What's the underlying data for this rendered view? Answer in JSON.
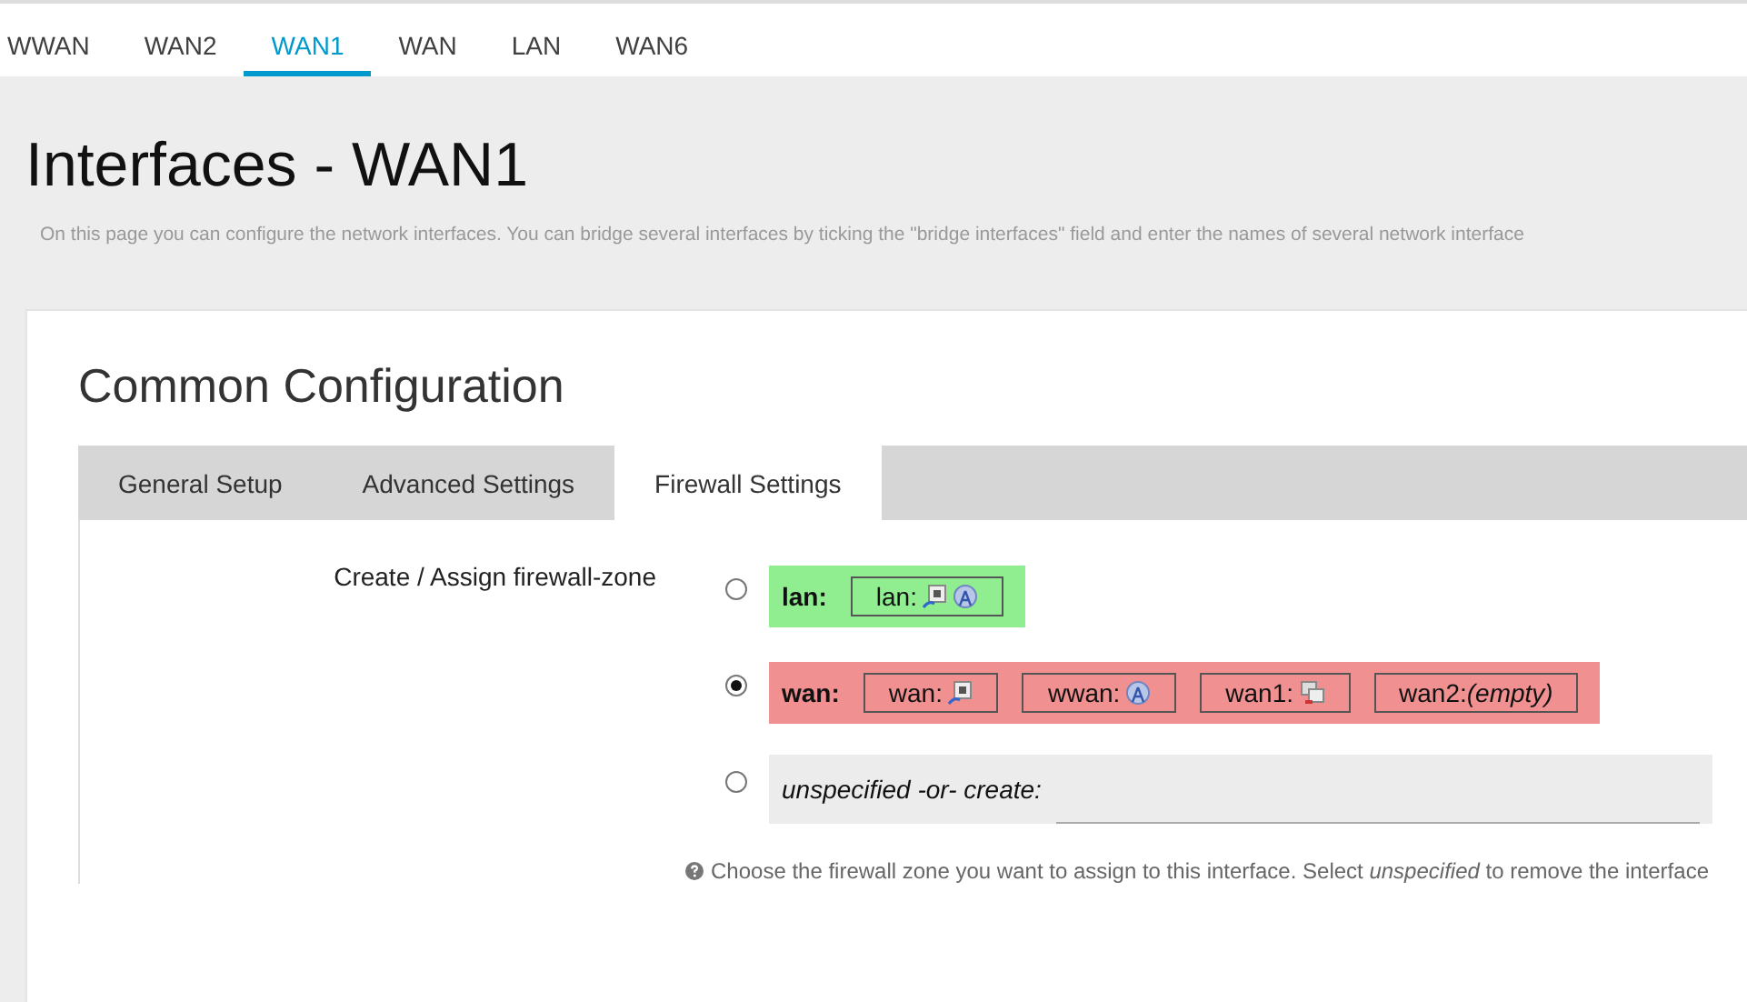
{
  "top_tabs": [
    {
      "label": "WWAN",
      "selected": false
    },
    {
      "label": "WAN2",
      "selected": false
    },
    {
      "label": "WAN1",
      "selected": true
    },
    {
      "label": "WAN",
      "selected": false
    },
    {
      "label": "LAN",
      "selected": false
    },
    {
      "label": "WAN6",
      "selected": false
    }
  ],
  "title": "Interfaces - WAN1",
  "description": "On this page you can configure the network interfaces. You can bridge several interfaces by ticking the \"bridge interfaces\" field and enter the names of several network interface",
  "section_title": "Common Configuration",
  "section_tabs": [
    {
      "label": "General Setup",
      "selected": false
    },
    {
      "label": "Advanced Settings",
      "selected": false
    },
    {
      "label": "Firewall Settings",
      "selected": true
    }
  ],
  "field_label": "Create / Assign firewall-zone",
  "zones": [
    {
      "kind": "zone",
      "name": "lan:",
      "color": "#90ee90",
      "selected": false,
      "members": [
        {
          "label": "lan:",
          "icons": [
            {
              "kind": "ethernet"
            },
            {
              "kind": "wireless"
            }
          ]
        }
      ]
    },
    {
      "kind": "zone",
      "name": "wan:",
      "color": "#f09090",
      "selected": true,
      "members": [
        {
          "label": "wan:",
          "icons": [
            {
              "kind": "ethernet"
            }
          ]
        },
        {
          "label": "wwan:",
          "icons": [
            {
              "kind": "wireless"
            }
          ]
        },
        {
          "label": "wan1:",
          "icons": [
            {
              "kind": "computer"
            }
          ]
        },
        {
          "label": "wan2:*(empty)*"
        }
      ]
    },
    {
      "kind": "create",
      "name": "unspecified -or- create:",
      "selected": false
    }
  ],
  "help": "Choose the firewall zone you want to assign to this interface. Select *unspecified* to remove the interface"
}
